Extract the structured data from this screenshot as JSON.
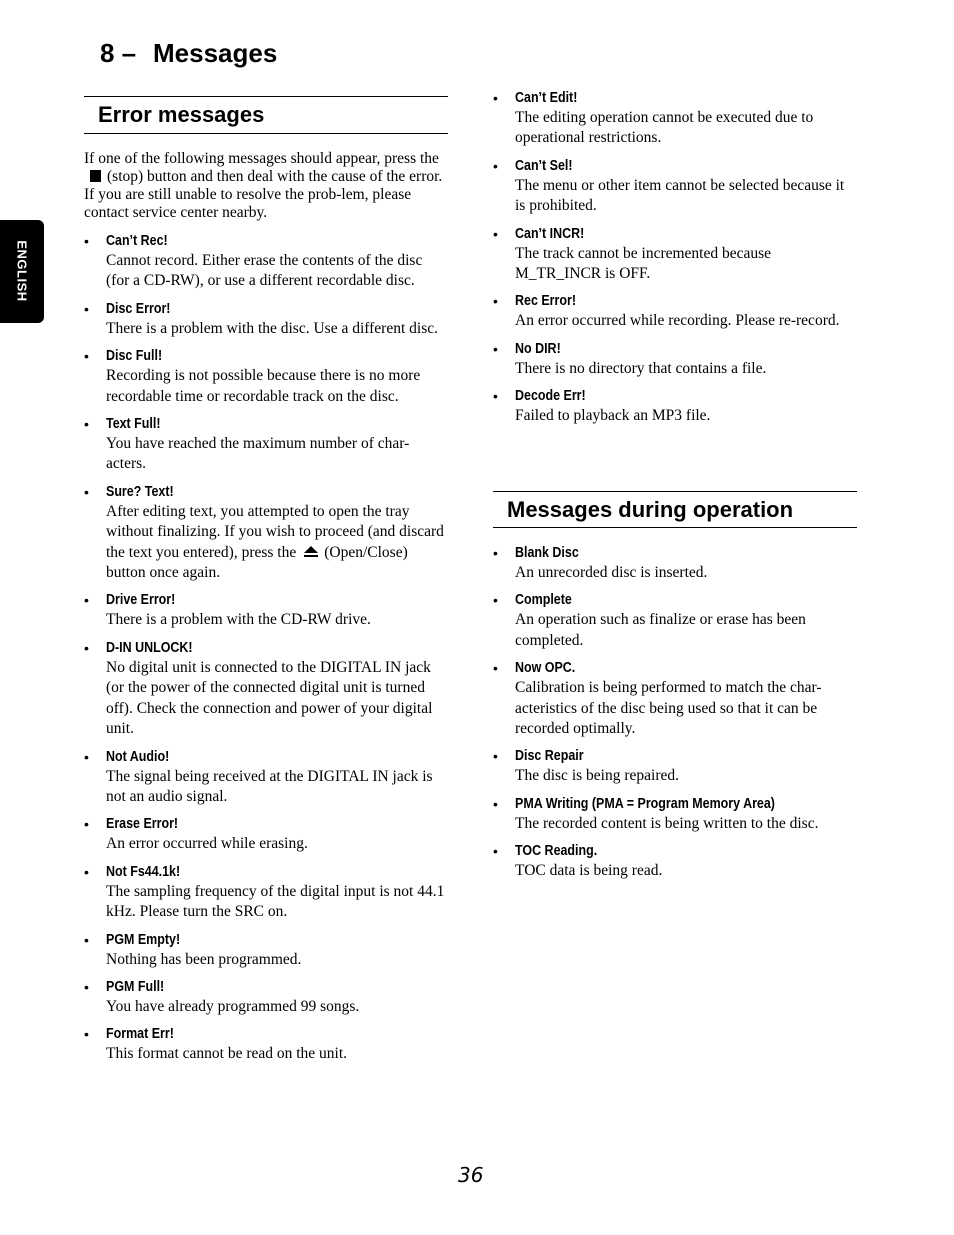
{
  "chapter": {
    "number": "8 –",
    "title": "Messages"
  },
  "language_tab": "ENGLISH",
  "error_section": {
    "heading": "Error messages",
    "intro": {
      "part1": "If one of the following messages should appear, press the",
      "icon": "stop-square-icon",
      "part2": "(stop) button and then deal with the cause of the error. If you are still unable to resolve the prob-lem, please contact service center nearby."
    },
    "items_left": [
      {
        "term": "Can’t Rec!",
        "desc": "Cannot record. Either erase the contents of the disc (for a CD-RW), or use a different recordable disc."
      },
      {
        "term": "Disc Error!",
        "desc": "There is a problem with the disc. Use a different disc."
      },
      {
        "term": "Disc Full!",
        "desc": "Recording is not possible because there is no more recordable time or recordable track on the disc."
      },
      {
        "term": "Text Full!",
        "desc": "You have reached the maximum number of char-acters."
      },
      {
        "term": "Sure? Text!",
        "desc_part1": "After editing text, you attempted to open the tray without finalizing. If you wish to proceed (and discard the text you entered), press the",
        "icon": "eject-icon",
        "desc_part2": "(Open/Close) button once again."
      },
      {
        "term": "Drive Error!",
        "desc": "There is a problem with the CD-RW drive."
      },
      {
        "term": "D-IN UNLOCK!",
        "desc": "No digital unit is connected to the DIGITAL IN jack (or the power of the connected digital unit is turned off). Check the connection and power of your digital unit."
      },
      {
        "term": "Not Audio!",
        "desc": "The signal being received at the DIGITAL IN jack is not an audio signal."
      },
      {
        "term": "Erase Error!",
        "desc": "An error occurred while erasing."
      },
      {
        "term": "Not Fs44.1k!",
        "desc": "The sampling frequency of the digital input is not 44.1 kHz. Please turn the SRC on."
      },
      {
        "term": "PGM Empty!",
        "desc": "Nothing has been programmed."
      },
      {
        "term": "PGM Full!",
        "desc": "You have already programmed 99 songs."
      },
      {
        "term": "Format Err!",
        "desc": "This format cannot be read on the unit."
      }
    ],
    "items_right": [
      {
        "term": "Can’t Edit!",
        "desc": "The editing operation cannot be executed due to operational restrictions."
      },
      {
        "term": "Can’t Sel!",
        "desc": "The menu or other item cannot be selected because it is prohibited."
      },
      {
        "term": "Can’t INCR!",
        "desc": "The track cannot be incremented because M_TR_INCR is OFF."
      },
      {
        "term": "Rec Error!",
        "desc": "An error occurred while recording. Please re-record."
      },
      {
        "term": "No DIR!",
        "desc": "There is no directory that contains a file."
      },
      {
        "term": "Decode Err!",
        "desc": "Failed to playback an MP3 file."
      }
    ]
  },
  "operation_section": {
    "heading": "Messages during operation",
    "items": [
      {
        "term": "Blank Disc",
        "desc": "An unrecorded disc is inserted."
      },
      {
        "term": "Complete",
        "desc": "An operation such as finalize or erase has been completed."
      },
      {
        "term": "Now OPC.",
        "desc": "Calibration is being performed to match the char-acteristics of the disc being used so that it can be recorded optimally."
      },
      {
        "term": "Disc Repair",
        "desc": "The disc is being repaired."
      },
      {
        "term": "PMA Writing (PMA = Program Memory Area)",
        "desc": "The recorded content is being written to the disc."
      },
      {
        "term": "TOC Reading.",
        "desc": "TOC data is being read."
      }
    ]
  },
  "page_number": "36"
}
